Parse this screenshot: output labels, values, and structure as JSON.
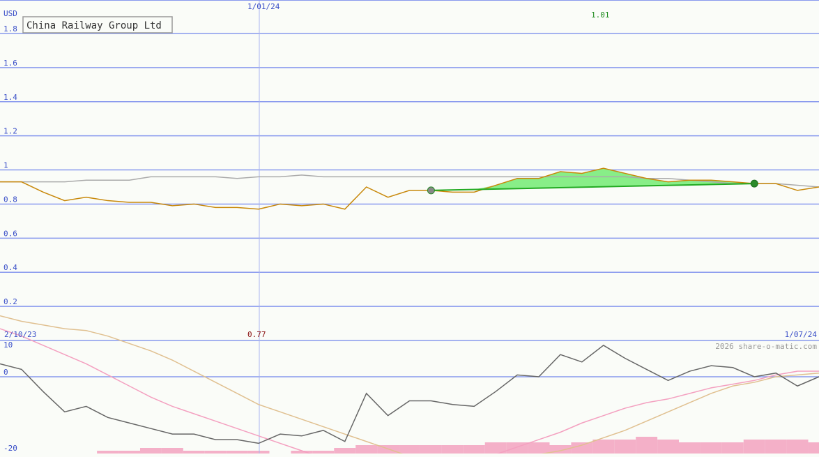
{
  "chart_data": [
    {
      "type": "line",
      "title": "China Railway Group Ltd",
      "ylabel": "USD",
      "ylim": [
        0,
        1.9
      ],
      "yticks": [
        "1.8",
        "1.6",
        "1.4",
        "1.2",
        "1",
        "0.8",
        "0.6",
        "0.4",
        "0.2"
      ],
      "ytick_values": [
        1.8,
        1.6,
        1.4,
        1.2,
        1.0,
        0.8,
        0.6,
        0.4,
        0.2
      ],
      "x_start_label": "2/10/23",
      "x_end_label": "1/07/24",
      "x_marker_label": "1/01/24",
      "low_label": "0.77",
      "high_label": "1.01",
      "credit": "2026 share-o-matic.com",
      "grid": true,
      "colors": {
        "price": "#c8880a",
        "moving_average": "#aaaaaa",
        "trend": "#22aa22",
        "fill": "#88ee88",
        "grid": "#8899ee"
      },
      "series": [
        {
          "values": [
            0.93,
            0.93,
            0.87,
            0.82,
            0.84,
            0.82,
            0.81,
            0.81,
            0.79,
            0.8,
            0.78,
            0.78,
            0.77,
            0.8,
            0.79,
            0.8,
            0.77,
            0.9,
            0.84,
            0.88,
            0.88,
            0.87,
            0.87,
            0.91,
            0.95,
            0.95,
            0.99,
            0.98,
            1.01,
            0.98,
            0.95,
            0.93,
            0.94,
            0.94,
            0.93,
            0.92,
            0.92,
            0.88,
            0.9
          ]
        },
        {
          "values": [
            0.93,
            0.93,
            0.93,
            0.93,
            0.94,
            0.94,
            0.94,
            0.96,
            0.96,
            0.96,
            0.96,
            0.95,
            0.96,
            0.96,
            0.97,
            0.96,
            0.96,
            0.96,
            0.96,
            0.96,
            0.96,
            0.96,
            0.96,
            0.96,
            0.96,
            0.96,
            0.96,
            0.96,
            0.96,
            0.96,
            0.95,
            0.95,
            0.94,
            0.93,
            0.92,
            0.92,
            0.92,
            0.91,
            0.9
          ]
        }
      ],
      "trend": {
        "start_index": 20,
        "end_index": 35,
        "start_value": 0.88,
        "end_value": 0.92
      }
    },
    {
      "type": "line",
      "yticks": [
        "10",
        "0",
        "-20"
      ],
      "ytick_values": [
        10,
        0,
        -20
      ],
      "ylim": [
        -20,
        10
      ],
      "colors": {
        "oscillator": "#666666",
        "signal_pink": "#f4a0c0",
        "signal_tan": "#e0c090",
        "volume": "#f4b0c8",
        "grid": "#8899ee"
      },
      "series": [
        {
          "values": [
            3.5,
            2,
            -4,
            -9.5,
            -8,
            -11,
            -12.5,
            -14,
            -15.5,
            -15.5,
            -17,
            -17,
            -18,
            -15.5,
            -16,
            -14.5,
            -17.5,
            -4.5,
            -10.5,
            -6.5,
            -6.5,
            -7.5,
            -8,
            -4,
            0.5,
            0,
            6,
            4,
            8.5,
            5,
            2,
            -1,
            1.5,
            3,
            2.5,
            0,
            1,
            -2.5,
            0
          ]
        },
        {
          "values": [
            13,
            11,
            8.5,
            6,
            3.5,
            0.5,
            -2.5,
            -5.5,
            -8,
            -10,
            -12,
            -14,
            -16,
            -18,
            -20,
            -22,
            -23.5,
            -24.5,
            -24.5,
            -24,
            -23.5,
            -23,
            -22,
            -21,
            -19,
            -17,
            -15,
            -12.5,
            -10.5,
            -8.5,
            -7,
            -6,
            -4.5,
            -3,
            -2,
            -1,
            0.5,
            1.5,
            1.5
          ]
        },
        {
          "values": [
            16.5,
            15,
            14,
            13,
            12.5,
            11,
            9,
            7,
            4.5,
            1.5,
            -1.5,
            -4.5,
            -7.5,
            -9.5,
            -11.5,
            -13.5,
            -15.5,
            -17.5,
            -19.5,
            -21.5,
            -22.5,
            -22.5,
            -22.5,
            -22,
            -21.5,
            -21,
            -20,
            -18.5,
            -16.5,
            -14.5,
            -12,
            -9.5,
            -7,
            -4.5,
            -2.5,
            -1.5,
            0,
            0.5,
            1
          ]
        }
      ],
      "volume": [
        0,
        0,
        0,
        0,
        0,
        1,
        1,
        2,
        2,
        1,
        1,
        1,
        1,
        0,
        1,
        1,
        2,
        3,
        3,
        3,
        3,
        3,
        3,
        4,
        4,
        4,
        3,
        4,
        5,
        5,
        6,
        5,
        4,
        4,
        4,
        5,
        5,
        5,
        4
      ]
    }
  ]
}
